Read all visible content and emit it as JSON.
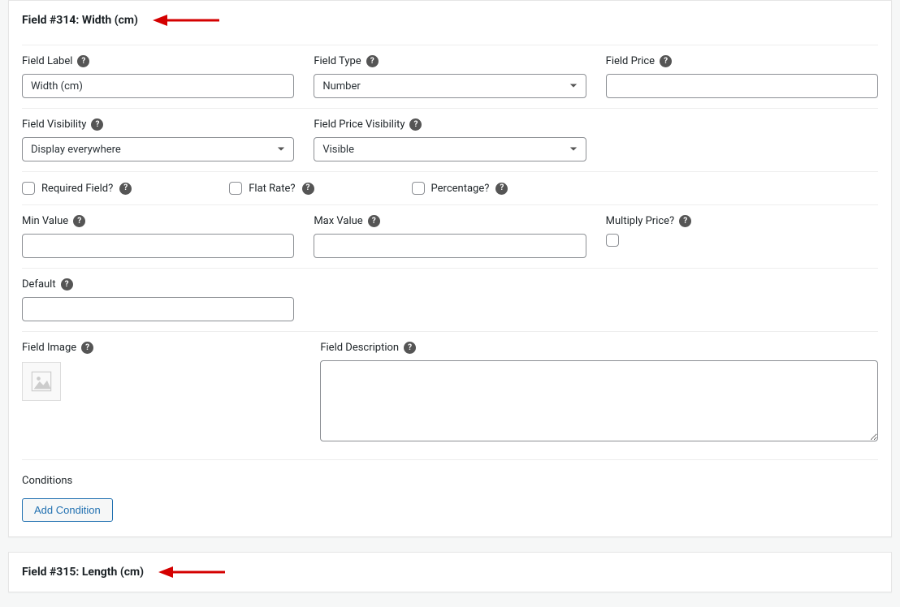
{
  "field314": {
    "header": "Field #314: Width (cm)",
    "labels": {
      "fieldLabel": "Field Label",
      "fieldType": "Field Type",
      "fieldPrice": "Field Price",
      "fieldVisibility": "Field Visibility",
      "fieldPriceVisibility": "Field Price Visibility",
      "required": "Required Field?",
      "flatRate": "Flat Rate?",
      "percentage": "Percentage?",
      "minValue": "Min Value",
      "maxValue": "Max Value",
      "multiplyPrice": "Multiply Price?",
      "default": "Default",
      "fieldImage": "Field Image",
      "fieldDescription": "Field Description",
      "conditions": "Conditions",
      "addCondition": "Add Condition"
    },
    "values": {
      "fieldLabel": "Width (cm)",
      "fieldType": "Number",
      "fieldPrice": "",
      "fieldVisibility": "Display everywhere",
      "fieldPriceVisibility": "Visible",
      "minValue": "",
      "maxValue": "",
      "default": "",
      "fieldDescription": ""
    }
  },
  "field315": {
    "header": "Field #315: Length (cm)"
  }
}
